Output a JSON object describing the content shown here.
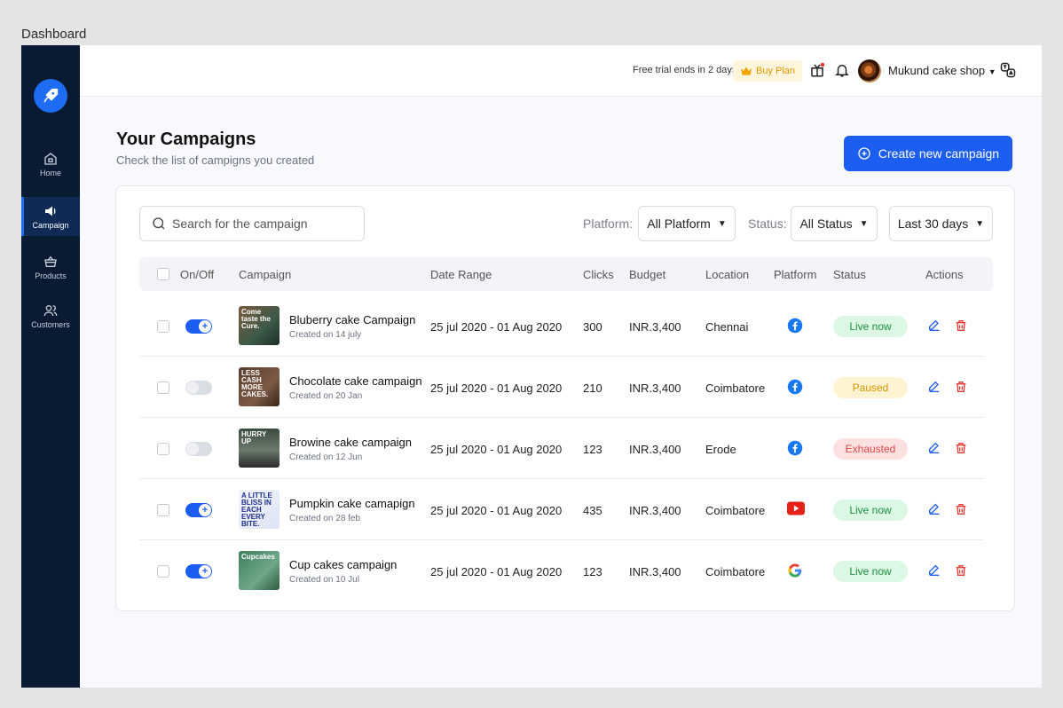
{
  "frame_label": "Dashboard",
  "sidebar": {
    "items": [
      {
        "label": "Home",
        "icon": "home-icon"
      },
      {
        "label": "Campaign",
        "icon": "megaphone-icon"
      },
      {
        "label": "Products",
        "icon": "basket-icon"
      },
      {
        "label": "Customers",
        "icon": "users-icon"
      }
    ]
  },
  "topbar": {
    "trial_text": "Free trial ends in 2 days",
    "buy_label": "Buy Plan",
    "shop_name": "Mukund cake shop"
  },
  "header": {
    "title": "Your Campaigns",
    "subtitle": "Check the list of campigns you created",
    "create_label": "Create new campaign"
  },
  "filters": {
    "search_placeholder": "Search for the campaign",
    "platform_label": "Platform:",
    "platform_value": "All Platform",
    "status_label": "Status:",
    "status_value": "All Status",
    "date_value": "Last 30 days"
  },
  "table": {
    "columns": [
      "On/Off",
      "Campaign",
      "Date Range",
      "Clicks",
      "Budget",
      "Location",
      "Platform",
      "Status",
      "Actions"
    ],
    "rows": [
      {
        "on": true,
        "name": "Bluberry cake Campaign",
        "created": "Created on 14 july",
        "thumb_text": "Come taste the Cure.",
        "date_range": "25 jul 2020 - 01 Aug 2020",
        "clicks": "300",
        "budget": "INR.3,400",
        "location": "Chennai",
        "platform": "facebook",
        "status": "Live now",
        "status_kind": "live"
      },
      {
        "on": false,
        "name": "Chocolate cake campaign",
        "created": "Created on 20 Jan",
        "thumb_text": "LESS CASH MORE CAKES.",
        "date_range": "25 jul 2020 - 01 Aug 2020",
        "clicks": "210",
        "budget": "INR.3,400",
        "location": "Coimbatore",
        "platform": "facebook",
        "status": "Paused",
        "status_kind": "paused"
      },
      {
        "on": false,
        "name": "Browine cake campaign",
        "created": "Created on 12 Jun",
        "thumb_text": "HURRY UP",
        "date_range": "25 jul 2020 - 01 Aug 2020",
        "clicks": "123",
        "budget": "INR.3,400",
        "location": "Erode",
        "platform": "facebook",
        "status": "Exhausted",
        "status_kind": "exhausted"
      },
      {
        "on": true,
        "name": "Pumpkin cake camapign",
        "created": "Created on 28 feb",
        "thumb_text": "A LITTLE BLISS IN EACH EVERY BITE.",
        "date_range": "25 jul 2020 - 01 Aug 2020",
        "clicks": "435",
        "budget": "INR.3,400",
        "location": "Coimbatore",
        "platform": "youtube",
        "status": "Live now",
        "status_kind": "live"
      },
      {
        "on": true,
        "name": "Cup cakes campaign",
        "created": "Created on 10 Jul",
        "thumb_text": "Cupcakes",
        "date_range": "25 jul 2020 - 01 Aug 2020",
        "clicks": "123",
        "budget": "INR.3,400",
        "location": "Coimbatore",
        "platform": "google",
        "status": "Live now",
        "status_kind": "live"
      }
    ]
  },
  "colors": {
    "sidebar": "#0b1a33",
    "accent": "#1d5ef2",
    "live": "#1c8f3f",
    "paused": "#d99500",
    "exhausted": "#e04747"
  }
}
